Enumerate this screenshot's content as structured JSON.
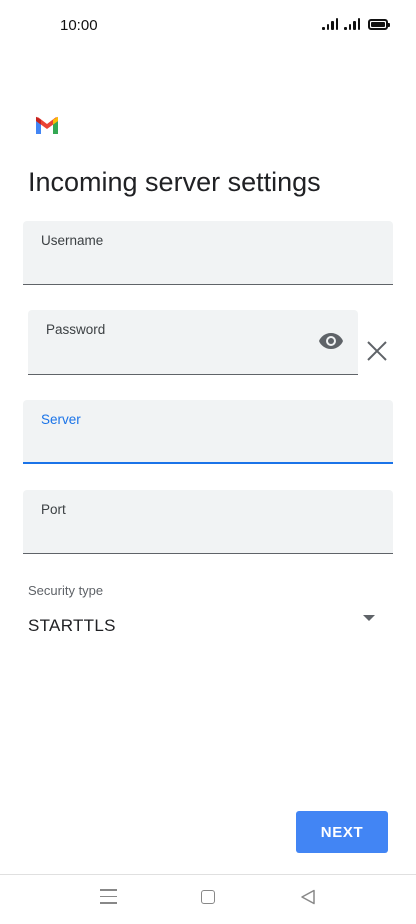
{
  "status_bar": {
    "time": "10:00"
  },
  "header": {
    "logo": "gmail-logo",
    "title": "Incoming server settings"
  },
  "form": {
    "username": {
      "label": "Username",
      "value": ""
    },
    "password": {
      "label": "Password",
      "value": ""
    },
    "server": {
      "label": "Server",
      "value": ""
    },
    "port": {
      "label": "Port",
      "value": ""
    },
    "security_type": {
      "label": "Security type",
      "value": "STARTTLS"
    }
  },
  "actions": {
    "next_label": "NEXT"
  },
  "colors": {
    "accent": "#1a73e8",
    "button": "#4285f4",
    "field_background": "#f1f3f4"
  },
  "icons": [
    "signal-icon",
    "battery-icon",
    "gmail-logo",
    "eye-icon",
    "close-icon",
    "chevron-down-icon",
    "menu-icon",
    "home-icon",
    "back-icon"
  ]
}
